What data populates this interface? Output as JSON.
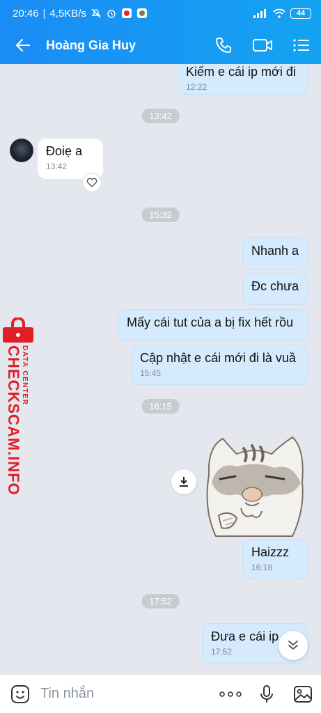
{
  "status_bar": {
    "time": "20:46",
    "speed": "4,5KB/s",
    "battery": "44"
  },
  "header": {
    "title": "Hoàng Gia Huy"
  },
  "messages": {
    "m1": {
      "text": "Kiếm e cái ip mới đi",
      "time": "12:22"
    },
    "sep1": "13:42",
    "m2": {
      "text": "Đoiẹ a",
      "time": "13:42"
    },
    "sep2": "15:32",
    "m3": {
      "text": "Nhanh a"
    },
    "m4": {
      "text": "Đc chưa"
    },
    "m5": {
      "text": "Mấy cái tut của a bị fix hết rồu"
    },
    "m6": {
      "text": "Cập nhật e cái mới đi là vuầ",
      "time": "15:45"
    },
    "sep3": "16:15",
    "m7": {
      "text": "Haizzz",
      "time": "16:18"
    },
    "sep4": "17:52",
    "m8": {
      "text": "Đưa e cái ip",
      "time": "17:52"
    }
  },
  "watermark": {
    "main": "CHECKSCAM.INFO",
    "sub": "DATA CENTER"
  },
  "input": {
    "placeholder": "Tin nhắn"
  },
  "colors": {
    "header": "#1a8cf5",
    "bubble_out": "#d5ebfd",
    "bubble_in": "#ffffff",
    "watermark": "#e01e28"
  }
}
